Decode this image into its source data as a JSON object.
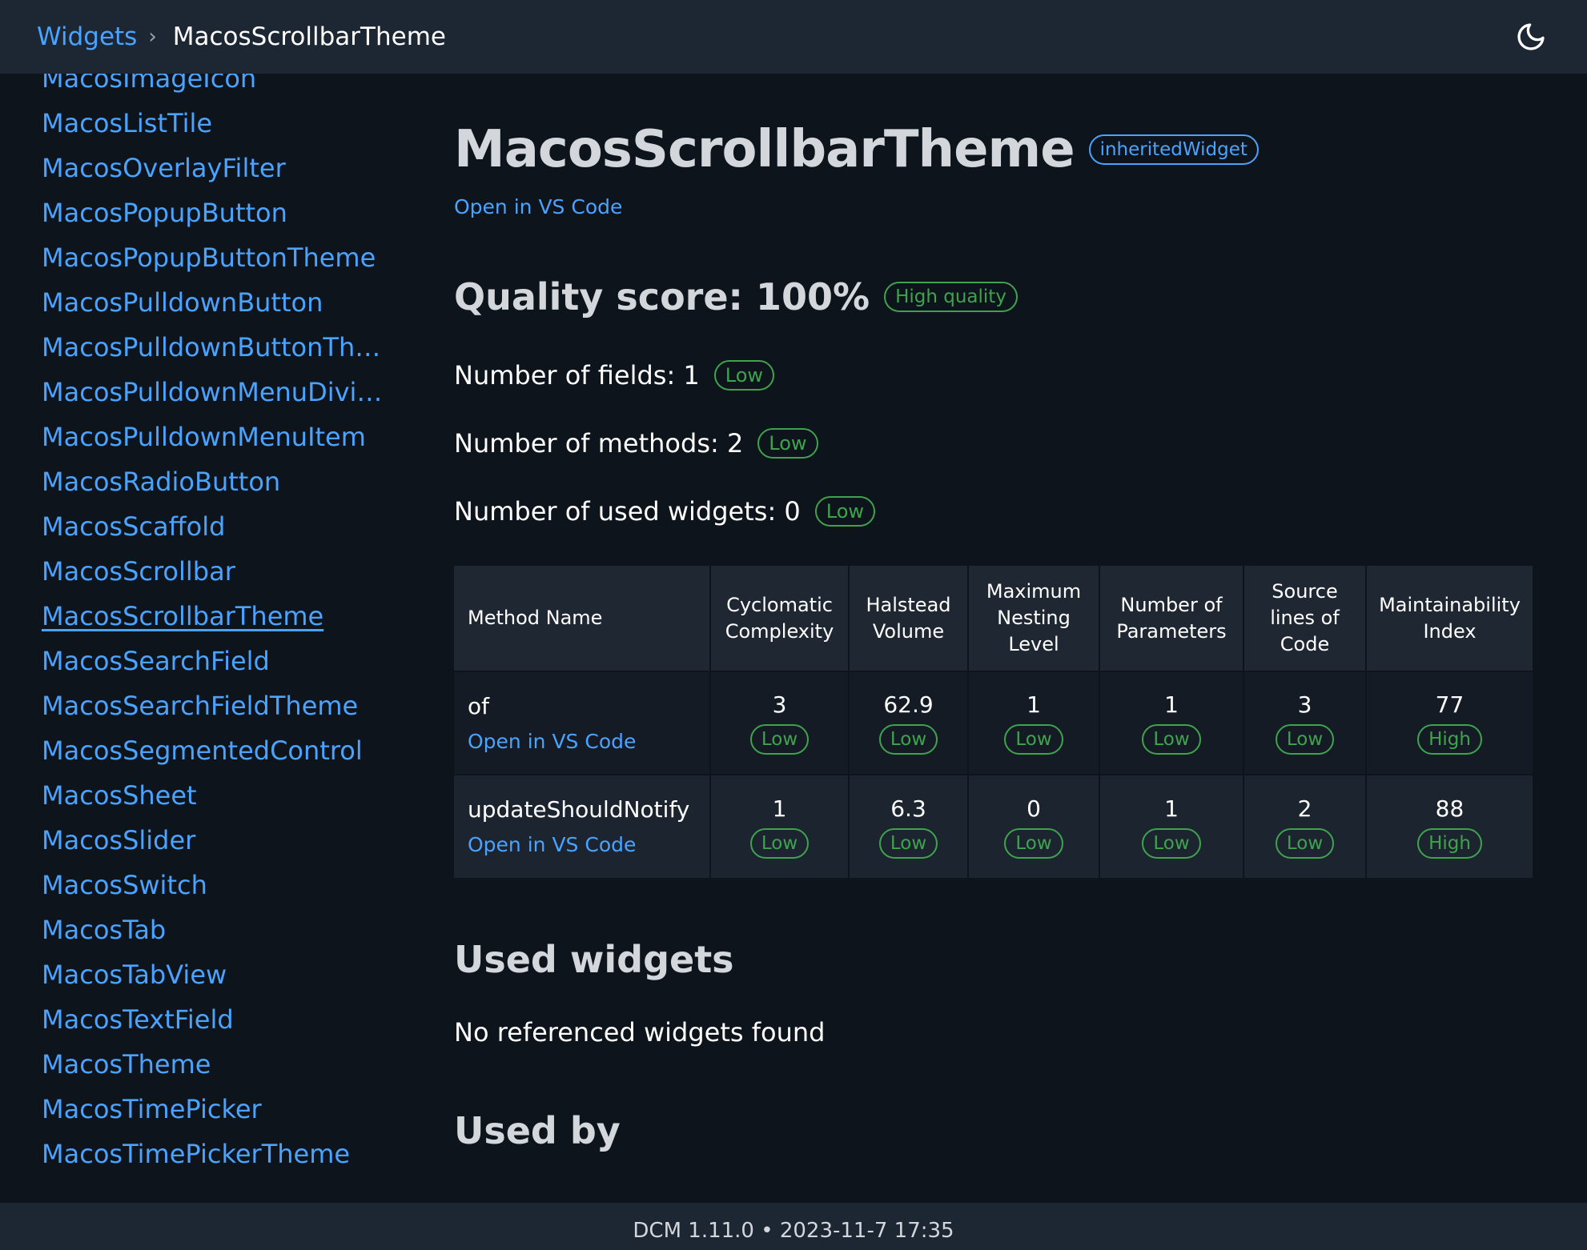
{
  "breadcrumb": {
    "root": "Widgets",
    "current": "MacosScrollbarTheme"
  },
  "theme_toggle_icon": "moon-icon",
  "sidebar": {
    "items": [
      "MacosImageIcon",
      "MacosListTile",
      "MacosOverlayFilter",
      "MacosPopupButton",
      "MacosPopupButtonTheme",
      "MacosPulldownButton",
      "MacosPulldownButtonThe...",
      "MacosPulldownMenuDivider",
      "MacosPulldownMenuItem",
      "MacosRadioButton",
      "MacosScaffold",
      "MacosScrollbar",
      "MacosScrollbarTheme",
      "MacosSearchField",
      "MacosSearchFieldTheme",
      "MacosSegmentedControl",
      "MacosSheet",
      "MacosSlider",
      "MacosSwitch",
      "MacosTab",
      "MacosTabView",
      "MacosTextField",
      "MacosTheme",
      "MacosTimePicker",
      "MacosTimePickerTheme"
    ],
    "active": "MacosScrollbarTheme"
  },
  "header": {
    "title": "MacosScrollbarTheme",
    "type_badge": "inheritedWidget",
    "open_link": "Open in VS Code"
  },
  "quality": {
    "title": "Quality score: 100%",
    "badge": "High quality"
  },
  "metrics": [
    {
      "label": "Number of fields: 1",
      "badge": "Low"
    },
    {
      "label": "Number of methods: 2",
      "badge": "Low"
    },
    {
      "label": "Number of used widgets: 0",
      "badge": "Low"
    }
  ],
  "table": {
    "headers": [
      "Method Name",
      "Cyclomatic Complexity",
      "Halstead Volume",
      "Maximum Nesting Level",
      "Number of Parameters",
      "Source lines of Code",
      "Maintainability Index"
    ],
    "rows": [
      {
        "name": "of",
        "link": "Open in VS Code",
        "cells": [
          {
            "value": "3",
            "badge": "Low"
          },
          {
            "value": "62.9",
            "badge": "Low"
          },
          {
            "value": "1",
            "badge": "Low"
          },
          {
            "value": "1",
            "badge": "Low"
          },
          {
            "value": "3",
            "badge": "Low"
          },
          {
            "value": "77",
            "badge": "High"
          }
        ]
      },
      {
        "name": "updateShouldNotify",
        "link": "Open in VS Code",
        "cells": [
          {
            "value": "1",
            "badge": "Low"
          },
          {
            "value": "6.3",
            "badge": "Low"
          },
          {
            "value": "0",
            "badge": "Low"
          },
          {
            "value": "1",
            "badge": "Low"
          },
          {
            "value": "2",
            "badge": "Low"
          },
          {
            "value": "88",
            "badge": "High"
          }
        ]
      }
    ]
  },
  "used_widgets": {
    "title": "Used widgets",
    "empty": "No referenced widgets found"
  },
  "used_by": {
    "title": "Used by"
  },
  "footer": "DCM 1.11.0 • 2023-11-7 17:35",
  "colors": {
    "accent": "#4aa3ff",
    "badge_green": "#3fa34d",
    "background": "#0e141c",
    "bar": "#1d2633"
  }
}
